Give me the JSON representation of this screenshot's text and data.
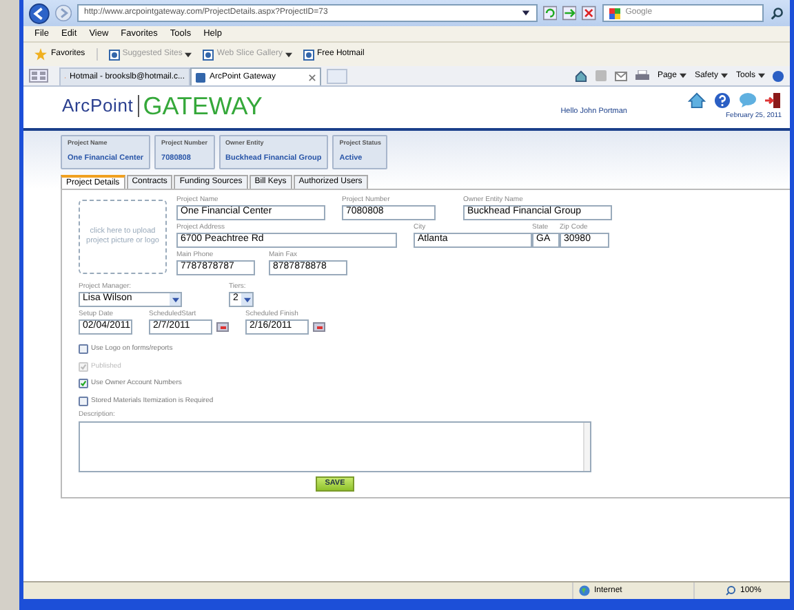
{
  "browser": {
    "url": "http://www.arcpointgateway.com/ProjectDetails.aspx?ProjectID=73",
    "search_placeholder": "Google",
    "menu": [
      "File",
      "Edit",
      "View",
      "Favorites",
      "Tools",
      "Help"
    ],
    "favorites_label": "Favorites",
    "favorites": [
      {
        "label": "Suggested Sites",
        "dropdown": true
      },
      {
        "label": "Web Slice Gallery",
        "dropdown": true
      },
      {
        "label": "Free Hotmail",
        "dropdown": false
      }
    ],
    "tabs": [
      {
        "label": "Hotmail - brookslb@hotmail.c...",
        "selected": false
      },
      {
        "label": "ArcPoint Gateway",
        "selected": true
      }
    ],
    "commands": [
      "Page",
      "Safety",
      "Tools"
    ],
    "status": {
      "zone": "Internet",
      "zoom": "100%"
    }
  },
  "header": {
    "brand": "ArcPoint",
    "product": "GATEWAY",
    "greeting": "Hello John Portman",
    "date": "February 25, 2011"
  },
  "summary": [
    {
      "label": "Project Name",
      "value": "One Financial Center"
    },
    {
      "label": "Project Number",
      "value": "7080808"
    },
    {
      "label": "Owner Entity",
      "value": "Buckhead Financial Group"
    },
    {
      "label": "Project Status",
      "value": "Active"
    }
  ],
  "tabs": [
    {
      "label": "Project Details",
      "selected": true
    },
    {
      "label": "Contracts",
      "selected": false
    },
    {
      "label": "Funding Sources",
      "selected": false
    },
    {
      "label": "Bill Keys",
      "selected": false
    },
    {
      "label": "Authorized Users",
      "selected": false
    }
  ],
  "upload_prompt": "click here to upload project picture or logo",
  "form_rows": [
    [
      {
        "label": "Project Name",
        "value": "One Financial  Center",
        "kind": "text"
      },
      {
        "label": "Project Number",
        "value": "7080808",
        "kind": "text"
      },
      {
        "label": "Owner Entity Name",
        "value": "Buckhead Financial Group",
        "kind": "text"
      }
    ],
    [
      {
        "label": "Project Address",
        "value": "6700 Peachtree Rd",
        "kind": "text"
      },
      {
        "label": "City",
        "value": "Atlanta",
        "kind": "text"
      },
      {
        "label": "State",
        "value": "GA",
        "kind": "text"
      },
      {
        "label": "Zip Code",
        "value": "30980",
        "kind": "text"
      }
    ],
    [
      {
        "label": "Main Phone",
        "value": "7787878787",
        "kind": "text"
      },
      {
        "label": "Main Fax",
        "value": "8787878878",
        "kind": "text"
      }
    ]
  ],
  "lower_rows": [
    [
      {
        "label": "Project Manager:",
        "value": "Lisa Wilson",
        "kind": "select"
      },
      {
        "label": "Tiers:",
        "value": "2",
        "kind": "select"
      }
    ],
    [
      {
        "label": "Setup Date",
        "value": "02/04/2011",
        "kind": "text"
      },
      {
        "label": "ScheduledStart",
        "value": "2/7/2011",
        "kind": "date"
      },
      {
        "label": "Scheduled Finish",
        "value": "2/16/2011",
        "kind": "date"
      }
    ]
  ],
  "options": [
    {
      "label": "Use Logo on forms/reports",
      "checked": false,
      "disabled": false
    },
    {
      "label": "Published",
      "checked": true,
      "disabled": true
    },
    {
      "label": "Use Owner Account Numbers",
      "checked": true,
      "disabled": false
    },
    {
      "label": "Stored Materials Itemization is Required",
      "checked": false,
      "disabled": false
    }
  ],
  "description_label": "Description:",
  "save_button": "SAVE"
}
